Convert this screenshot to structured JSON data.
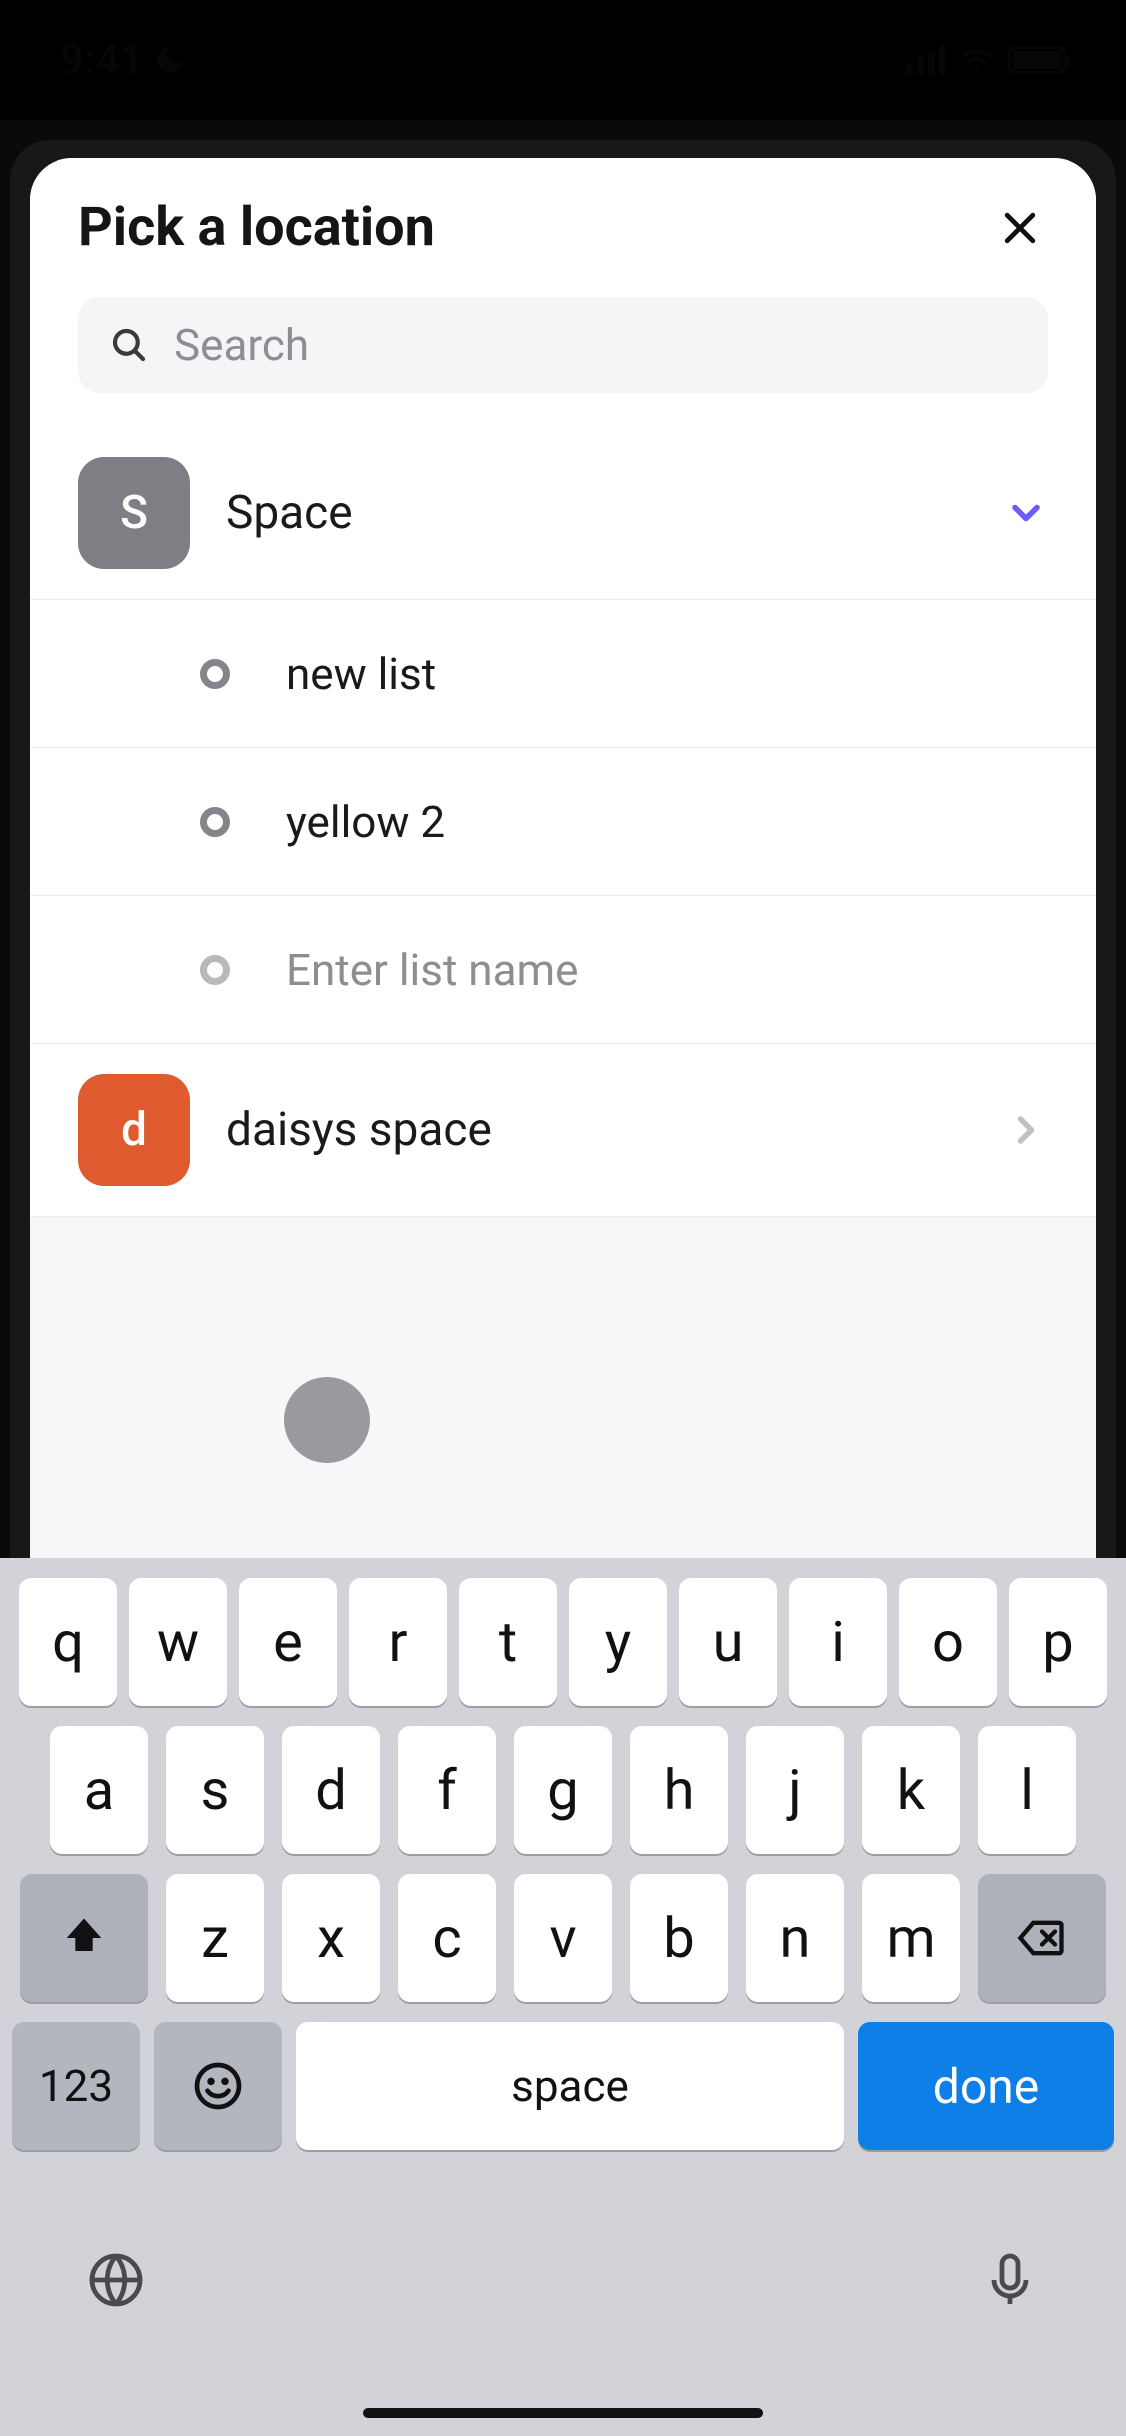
{
  "status": {
    "time": "9:41"
  },
  "sheet": {
    "title": "Pick a location",
    "search_placeholder": "Search"
  },
  "space": {
    "badge_letter": "S",
    "title": "Space",
    "lists": [
      {
        "name": "new list"
      },
      {
        "name": "yellow 2"
      }
    ],
    "new_list_placeholder": "Enter list name",
    "badge_color": "#7e7e85"
  },
  "other_space": {
    "badge_letter": "d",
    "title": "daisys space",
    "badge_color": "#df5a2e"
  },
  "keyboard": {
    "row1": [
      "q",
      "w",
      "e",
      "r",
      "t",
      "y",
      "u",
      "i",
      "o",
      "p"
    ],
    "row2": [
      "a",
      "s",
      "d",
      "f",
      "g",
      "h",
      "j",
      "k",
      "l"
    ],
    "row3": [
      "z",
      "x",
      "c",
      "v",
      "b",
      "n",
      "m"
    ],
    "numbers_label": "123",
    "space_label": "space",
    "done_label": "done"
  },
  "colors": {
    "accent_purple": "#6a5cff",
    "done_blue": "#0f7fe8",
    "orange": "#df5a2e",
    "gray_badge": "#7e7e85"
  }
}
